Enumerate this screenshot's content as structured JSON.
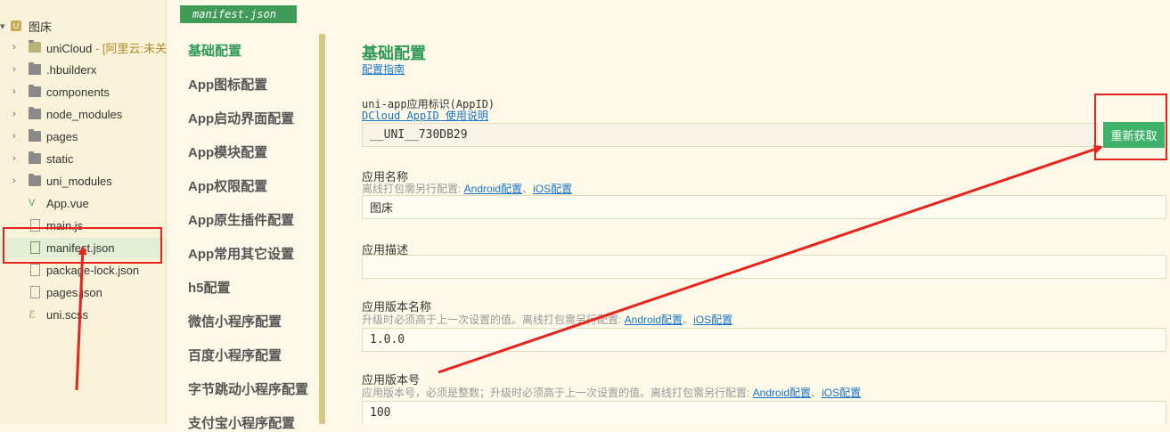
{
  "tree": {
    "root": {
      "label": "图床",
      "badge": "U"
    },
    "items": [
      {
        "label": "uniCloud",
        "suffix": " - [阿里云:未关",
        "type": "cloud-folder"
      },
      {
        "label": ".hbuilderx",
        "type": "folder"
      },
      {
        "label": "components",
        "type": "folder"
      },
      {
        "label": "node_modules",
        "type": "folder"
      },
      {
        "label": "pages",
        "type": "folder"
      },
      {
        "label": "static",
        "type": "folder"
      },
      {
        "label": "uni_modules",
        "type": "folder"
      },
      {
        "label": "App.vue",
        "type": "vue-file"
      },
      {
        "label": "main.js",
        "type": "file"
      },
      {
        "label": "manifest.json",
        "type": "json-file",
        "selected": true
      },
      {
        "label": "package-lock.json",
        "type": "file"
      },
      {
        "label": "pages.json",
        "type": "file"
      },
      {
        "label": "uni.scss",
        "type": "file"
      }
    ]
  },
  "editor_tab": {
    "label": "manifest.json"
  },
  "config_nav": {
    "items": [
      {
        "label": "基础配置",
        "active": true
      },
      {
        "label": "App图标配置"
      },
      {
        "label": "App启动界面配置"
      },
      {
        "label": "App模块配置"
      },
      {
        "label": "App权限配置"
      },
      {
        "label": "App原生插件配置"
      },
      {
        "label": "App常用其它设置"
      },
      {
        "label": "h5配置"
      },
      {
        "label": "微信小程序配置"
      },
      {
        "label": "百度小程序配置"
      },
      {
        "label": "字节跳动小程序配置"
      },
      {
        "label": "支付宝小程序配置"
      }
    ]
  },
  "main": {
    "title": "基础配置",
    "guide_link": "配置指南",
    "appid": {
      "label": "uni-app应用标识(AppID)",
      "help_link": "DCloud AppID 使用说明",
      "value": "__UNI__730DB29",
      "refetch_button": "重新获取"
    },
    "app_name": {
      "label": "应用名称",
      "hint": "离线打包需另行配置: ",
      "android_link": "Android配置",
      "sep": "、",
      "ios_link": "iOS配置",
      "value": "图床"
    },
    "app_desc": {
      "label": "应用描述",
      "value": ""
    },
    "version_name": {
      "label": "应用版本名称",
      "hint": "升级时必须高于上一次设置的值。离线打包需另行配置: ",
      "android_link": "Android配置",
      "sep": "、",
      "ios_link": "iOS配置",
      "value": "1.0.0"
    },
    "version_code": {
      "label": "应用版本号",
      "hint": "应用版本号，必须是整数；升级时必须高于上一次设置的值。离线打包需另行配置: ",
      "android_link": "Android配置",
      "sep": "、",
      "ios_link": "iOS配置",
      "value": "100"
    }
  },
  "colors": {
    "accent": "#2e9a56",
    "button": "#3fb26a",
    "annotation": "#e8221c",
    "link": "#1a73c8"
  }
}
